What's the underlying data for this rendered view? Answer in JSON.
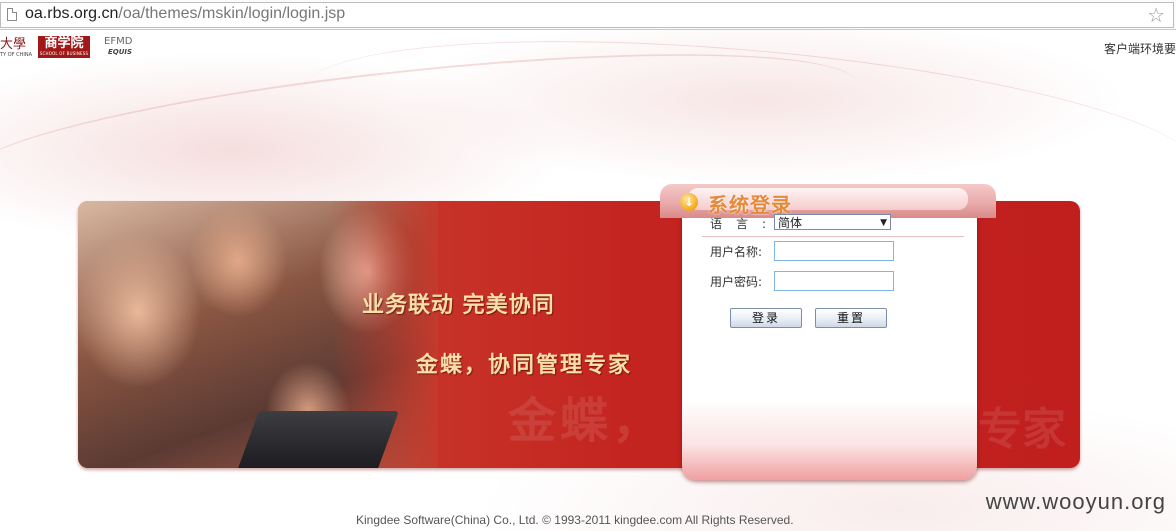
{
  "browser": {
    "url_host": "oa.rbs.org.cn",
    "url_path": "/oa/themes/mskin/login/login.jsp"
  },
  "header": {
    "univ_logo_text": "大學",
    "univ_logo_sub": "TY OF CHINA",
    "school_logo_cn": "商学院",
    "school_logo_en": "SCHOOL OF BUSINESS",
    "equis_mark": "EFMD",
    "equis_text": "EQUIS",
    "client_env": "客户端环境要"
  },
  "banner": {
    "slogan_1": "业务联动 完美协同",
    "slogan_2": "金蝶，协同管理专家",
    "watermark_1": "金蝶，",
    "watermark_2": "专家"
  },
  "login": {
    "title": "系统登录",
    "language_label": "语言:",
    "language_value": "简体",
    "username_label": "用户名称:",
    "username_value": "",
    "password_label": "用户密码:",
    "password_value": "",
    "login_button": "登录",
    "reset_button": "重置"
  },
  "footer": {
    "copyright": "Kingdee Software(China) Co., Ltd. © 1993-2011 kingdee.com All Rights Reserved.",
    "site_mark": "www.wooyun.org"
  },
  "colors": {
    "banner_red": "#c42420",
    "slogan_gold": "#f7dfa8",
    "title_orange": "#e48a3a",
    "input_border": "#7fb6e6"
  },
  "icons": [
    "page-icon",
    "bookmark-star-icon",
    "login-arrow-icon",
    "dropdown-caret-icon"
  ]
}
